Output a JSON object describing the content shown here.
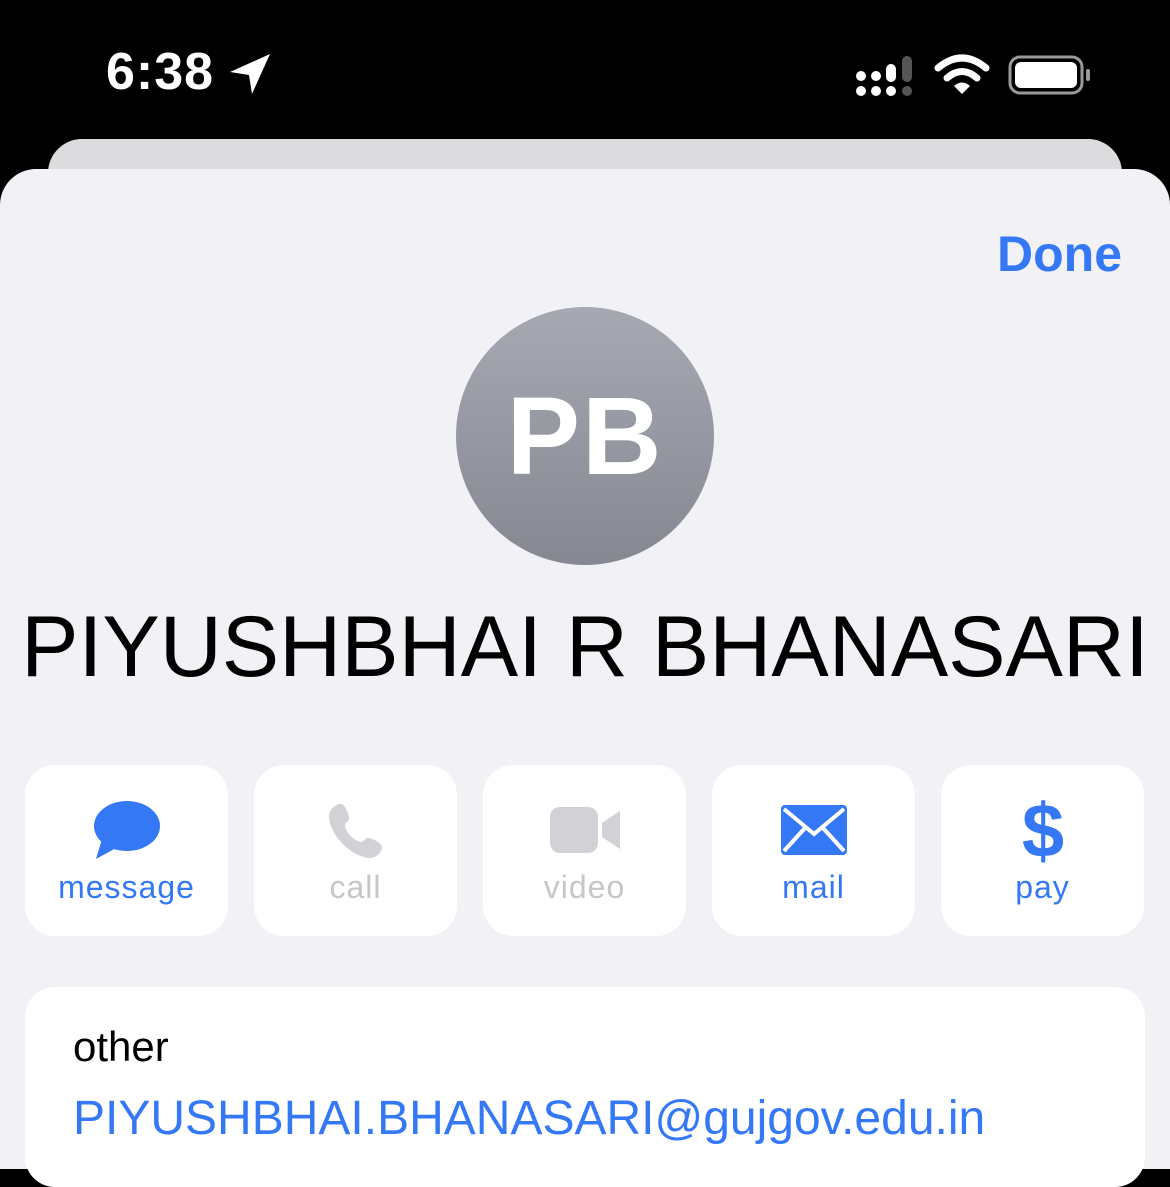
{
  "status_bar": {
    "time": "6:38",
    "icons": [
      "location-arrow-icon",
      "cellular-signal-icon",
      "wifi-icon",
      "battery-icon"
    ]
  },
  "header": {
    "done_label": "Done"
  },
  "contact": {
    "initials": "PB",
    "name": "PIYUSHBHAI R BHANASARI"
  },
  "actions": [
    {
      "label": "message",
      "icon": "message-bubble-icon",
      "enabled": true
    },
    {
      "label": "call",
      "icon": "phone-icon",
      "enabled": false
    },
    {
      "label": "video",
      "icon": "video-camera-icon",
      "enabled": false
    },
    {
      "label": "mail",
      "icon": "envelope-icon",
      "enabled": true
    },
    {
      "label": "pay",
      "icon": "dollar-icon",
      "enabled": true
    }
  ],
  "email_field": {
    "label": "other",
    "value": "PIYUSHBHAI.BHANASARI@gujgov.edu.in"
  },
  "colors": {
    "accent": "#3478f6",
    "disabled": "#c6c6c8",
    "sheet_background": "#f1f1f6",
    "avatar": "#999ca5"
  }
}
